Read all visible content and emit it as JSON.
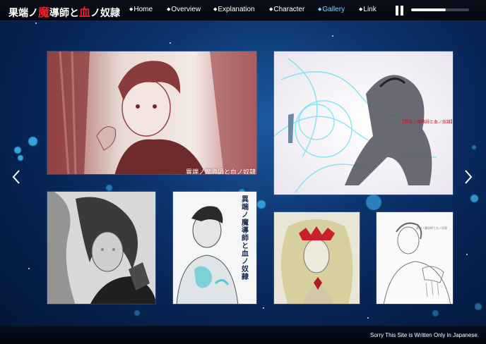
{
  "header": {
    "logo_parts": [
      "果端",
      "ノ",
      "魔",
      "導師",
      "と",
      "血",
      "ノ",
      "奴隷"
    ],
    "nav": [
      {
        "label": "Home"
      },
      {
        "label": "Overview"
      },
      {
        "label": "Explanation"
      },
      {
        "label": "Character"
      },
      {
        "label": "Gallery"
      },
      {
        "label": "Link"
      }
    ],
    "active_nav": "Gallery",
    "nav_marker": "◆",
    "volume_level": 0.6
  },
  "gallery": {
    "captions": {
      "image_1": "異端ノ魔導師と血ノ奴隷",
      "image_2": "【異端ノ魔導師と血ノ奴隷】",
      "image_4_vertical": "異端ノ魔導師と血ノ奴隷",
      "image_7": "異端ノ魔導師と血ノ奴隷"
    }
  },
  "footer": {
    "note": "Sorry This Site is Written Only in Japanese."
  },
  "colors": {
    "accent": "#7fd6ff",
    "logo_red": "#e8202a",
    "caption_red": "#c8102e"
  }
}
